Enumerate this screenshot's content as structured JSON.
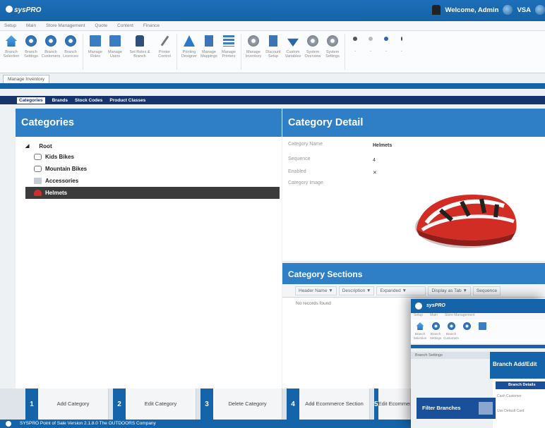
{
  "app": {
    "logo_text": "sysPRO",
    "welcome": "Welcome, Admin",
    "store_code": "VSA"
  },
  "menu": [
    "Setup",
    "Main",
    "Store Management",
    "Quote",
    "Content",
    "Finance"
  ],
  "ribbon": [
    {
      "label": "Branch Selection",
      "icon": "house"
    },
    {
      "label": "Branch Settings",
      "icon": "gear"
    },
    {
      "label": "Branch Customers",
      "icon": "gear"
    },
    {
      "label": "Branch Licences",
      "icon": "gear"
    },
    {
      "label": "Manage Roles",
      "icon": "folder"
    },
    {
      "label": "Manage Users",
      "icon": "folder"
    },
    {
      "label": "Set Roles & Branch",
      "icon": "lock"
    },
    {
      "label": "Printer Control",
      "icon": "brush"
    },
    {
      "label": "Printing Designer",
      "icon": "tri"
    },
    {
      "label": "Manage Mappings",
      "icon": "doc"
    },
    {
      "label": "Manage Printers",
      "icon": "bars"
    },
    {
      "label": "Manage Inventory",
      "icon": "grey"
    },
    {
      "label": "Discount Setup",
      "icon": "doc"
    },
    {
      "label": "Custom Variables",
      "icon": "down"
    },
    {
      "label": "System Overview",
      "icon": "grey"
    },
    {
      "label": "System Settings",
      "icon": "grey"
    }
  ],
  "doc_tab": "Manage Inventory",
  "sub_tabs": [
    "Categories",
    "Brands",
    "Stock Codes",
    "Product Classes"
  ],
  "categories": {
    "title": "Categories",
    "root": "Root",
    "items": [
      {
        "label": "Kids Bikes",
        "icon": "bike"
      },
      {
        "label": "Mountain Bikes",
        "icon": "bike"
      },
      {
        "label": "Accessories",
        "icon": "box"
      },
      {
        "label": "Helmets",
        "icon": "helm",
        "selected": true
      }
    ]
  },
  "detail": {
    "title": "Category Detail",
    "fields": [
      {
        "label": "Category Name",
        "value": "Helmets"
      },
      {
        "label": "Sequence",
        "value": "4"
      },
      {
        "label": "Enabled",
        "value": "✕"
      },
      {
        "label": "Category Image",
        "value": ""
      }
    ]
  },
  "sections": {
    "title": "Category Sections",
    "columns": [
      "Header Name",
      "Description",
      "Expanded",
      "Display as Tab",
      "Sequence"
    ],
    "empty": "No records found"
  },
  "actions": [
    {
      "num": "1",
      "label": "Add Category"
    },
    {
      "num": "2",
      "label": "Edit Category"
    },
    {
      "num": "3",
      "label": "Delete Category"
    },
    {
      "num": "4",
      "label": "Add Ecommerce Section"
    },
    {
      "num": "5",
      "label": "Edit Ecommerce Section"
    }
  ],
  "status": "SYSPRO Point of Sale Version 2.1.8.0 The OUTDOORS Company",
  "overlay": {
    "logo_text": "sysPRO",
    "menu": [
      "Setup",
      "Main",
      "Store Management"
    ],
    "ribbon": [
      "Branch Selection",
      "Branch Settings",
      "Branch Customers",
      "",
      ""
    ],
    "branch_settings": "Branch Settings",
    "title": "Branch Add/Edit",
    "filter": "Filter Branches",
    "detail": "Branch Details",
    "lines": [
      "Cash Customer",
      "Use Default Card"
    ]
  },
  "colors": {
    "primary": "#1563a8",
    "panel": "#2f7fc6",
    "dark": "#16336c"
  }
}
